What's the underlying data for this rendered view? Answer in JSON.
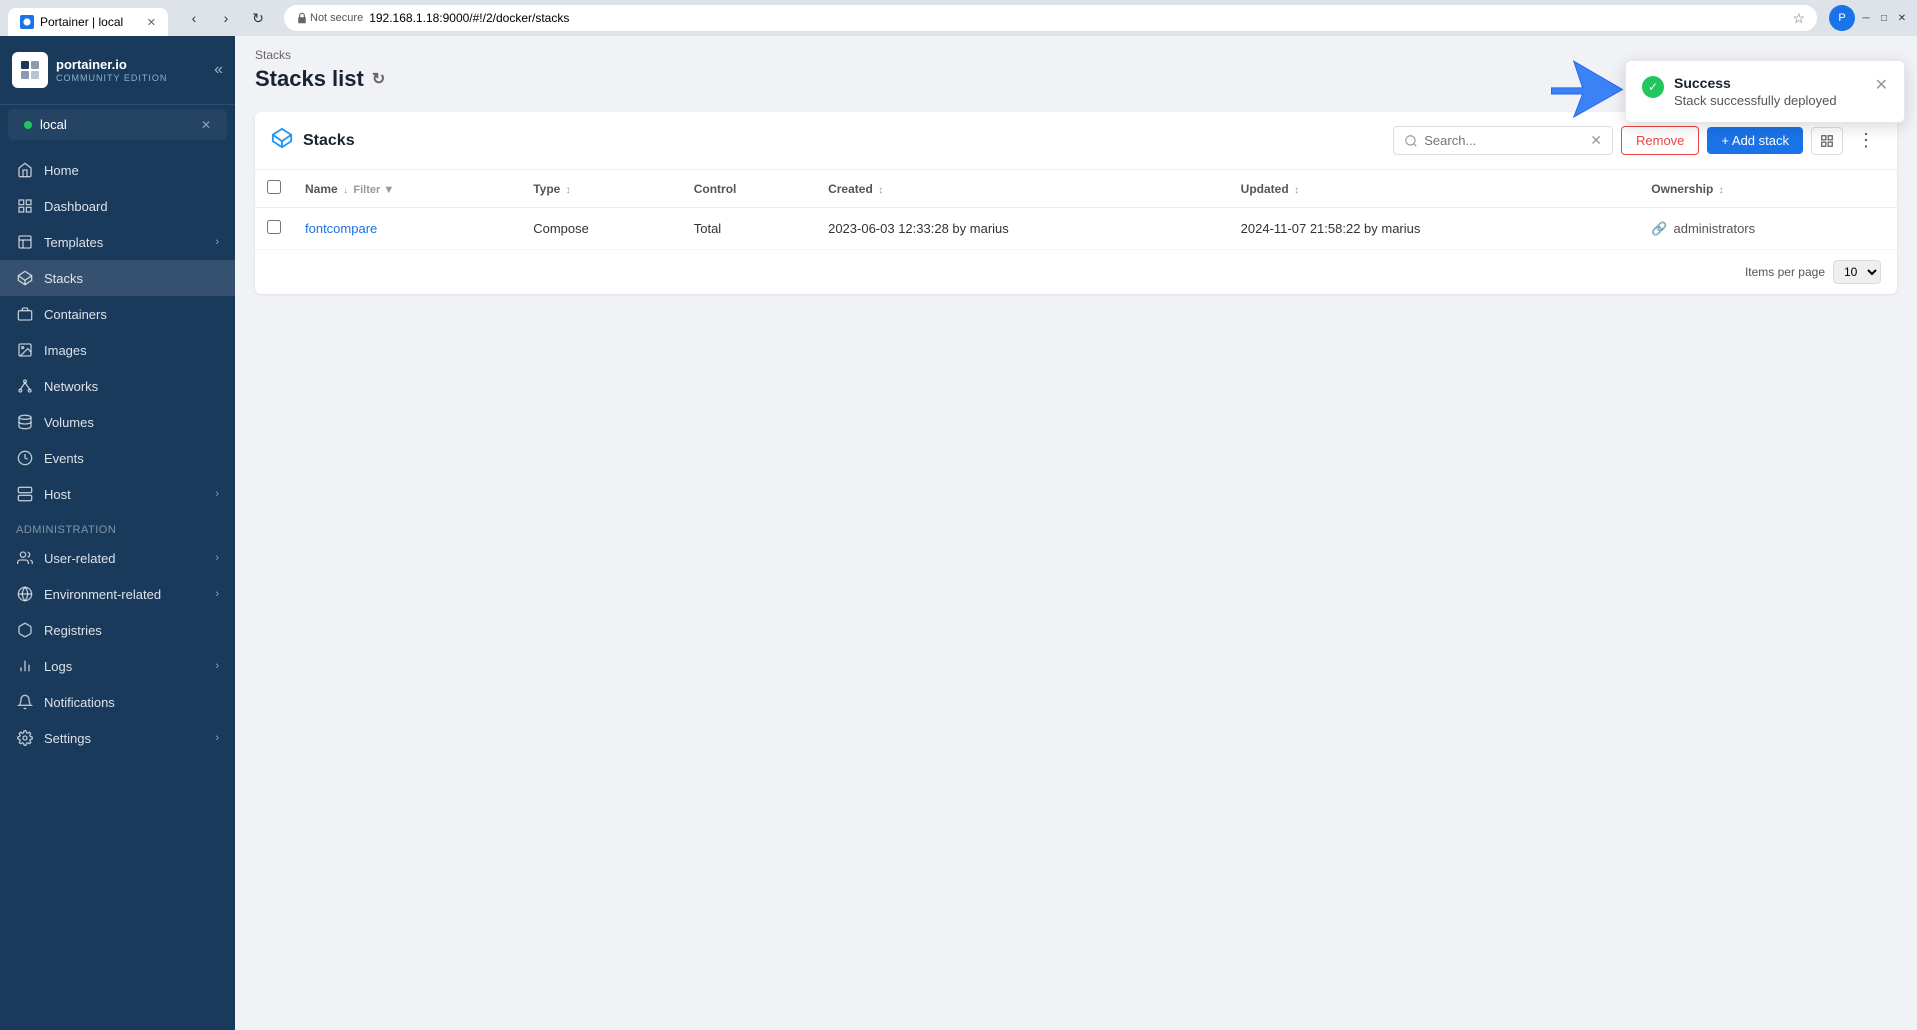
{
  "browser": {
    "tab_title": "Portainer | local",
    "url": "192.168.1.18:9000/#!/2/docker/stacks",
    "not_secure_text": "Not secure"
  },
  "sidebar": {
    "logo_name": "portainer.io",
    "logo_sub": "COMMUNITY EDITION",
    "endpoint": {
      "name": "local",
      "status": "connected"
    },
    "nav_items": [
      {
        "id": "home",
        "label": "Home",
        "icon": "house"
      },
      {
        "id": "dashboard",
        "label": "Dashboard",
        "icon": "grid"
      },
      {
        "id": "templates",
        "label": "Templates",
        "icon": "template",
        "has_chevron": true
      },
      {
        "id": "stacks",
        "label": "Stacks",
        "icon": "layers",
        "active": true
      },
      {
        "id": "containers",
        "label": "Containers",
        "icon": "box"
      },
      {
        "id": "images",
        "label": "Images",
        "icon": "image"
      },
      {
        "id": "networks",
        "label": "Networks",
        "icon": "network"
      },
      {
        "id": "volumes",
        "label": "Volumes",
        "icon": "database"
      },
      {
        "id": "events",
        "label": "Events",
        "icon": "activity"
      },
      {
        "id": "host",
        "label": "Host",
        "icon": "server",
        "has_chevron": true
      }
    ],
    "administration_label": "Administration",
    "admin_items": [
      {
        "id": "user-related",
        "label": "User-related",
        "icon": "users",
        "has_chevron": true
      },
      {
        "id": "environment-related",
        "label": "Environment-related",
        "icon": "globe",
        "has_chevron": true
      },
      {
        "id": "registries",
        "label": "Registries",
        "icon": "registry"
      },
      {
        "id": "logs",
        "label": "Logs",
        "icon": "bar-chart",
        "has_chevron": true
      },
      {
        "id": "notifications",
        "label": "Notifications",
        "icon": "bell"
      },
      {
        "id": "settings",
        "label": "Settings",
        "icon": "settings",
        "has_chevron": true
      }
    ]
  },
  "page": {
    "breadcrumb": "Stacks",
    "title": "Stacks list"
  },
  "stacks_table": {
    "title": "Stacks",
    "search_placeholder": "Search...",
    "btn_remove": "Remove",
    "btn_add": "+ Add stack",
    "columns": [
      {
        "key": "name",
        "label": "Name",
        "sortable": true,
        "filterable": true
      },
      {
        "key": "type",
        "label": "Type",
        "sortable": true
      },
      {
        "key": "control",
        "label": "Control"
      },
      {
        "key": "created",
        "label": "Created",
        "sortable": true
      },
      {
        "key": "updated",
        "label": "Updated",
        "sortable": true
      },
      {
        "key": "ownership",
        "label": "Ownership",
        "sortable": true
      }
    ],
    "rows": [
      {
        "name": "fontcompare",
        "type": "Compose",
        "control": "Total",
        "created": "2023-06-03 12:33:28 by marius",
        "updated": "2024-11-07 21:58:22 by marius",
        "ownership": "administrators"
      }
    ],
    "items_per_page_label": "Items per page",
    "items_per_page_value": "10"
  },
  "toast": {
    "title": "Success",
    "message": "Stack successfully deployed",
    "type": "success"
  }
}
